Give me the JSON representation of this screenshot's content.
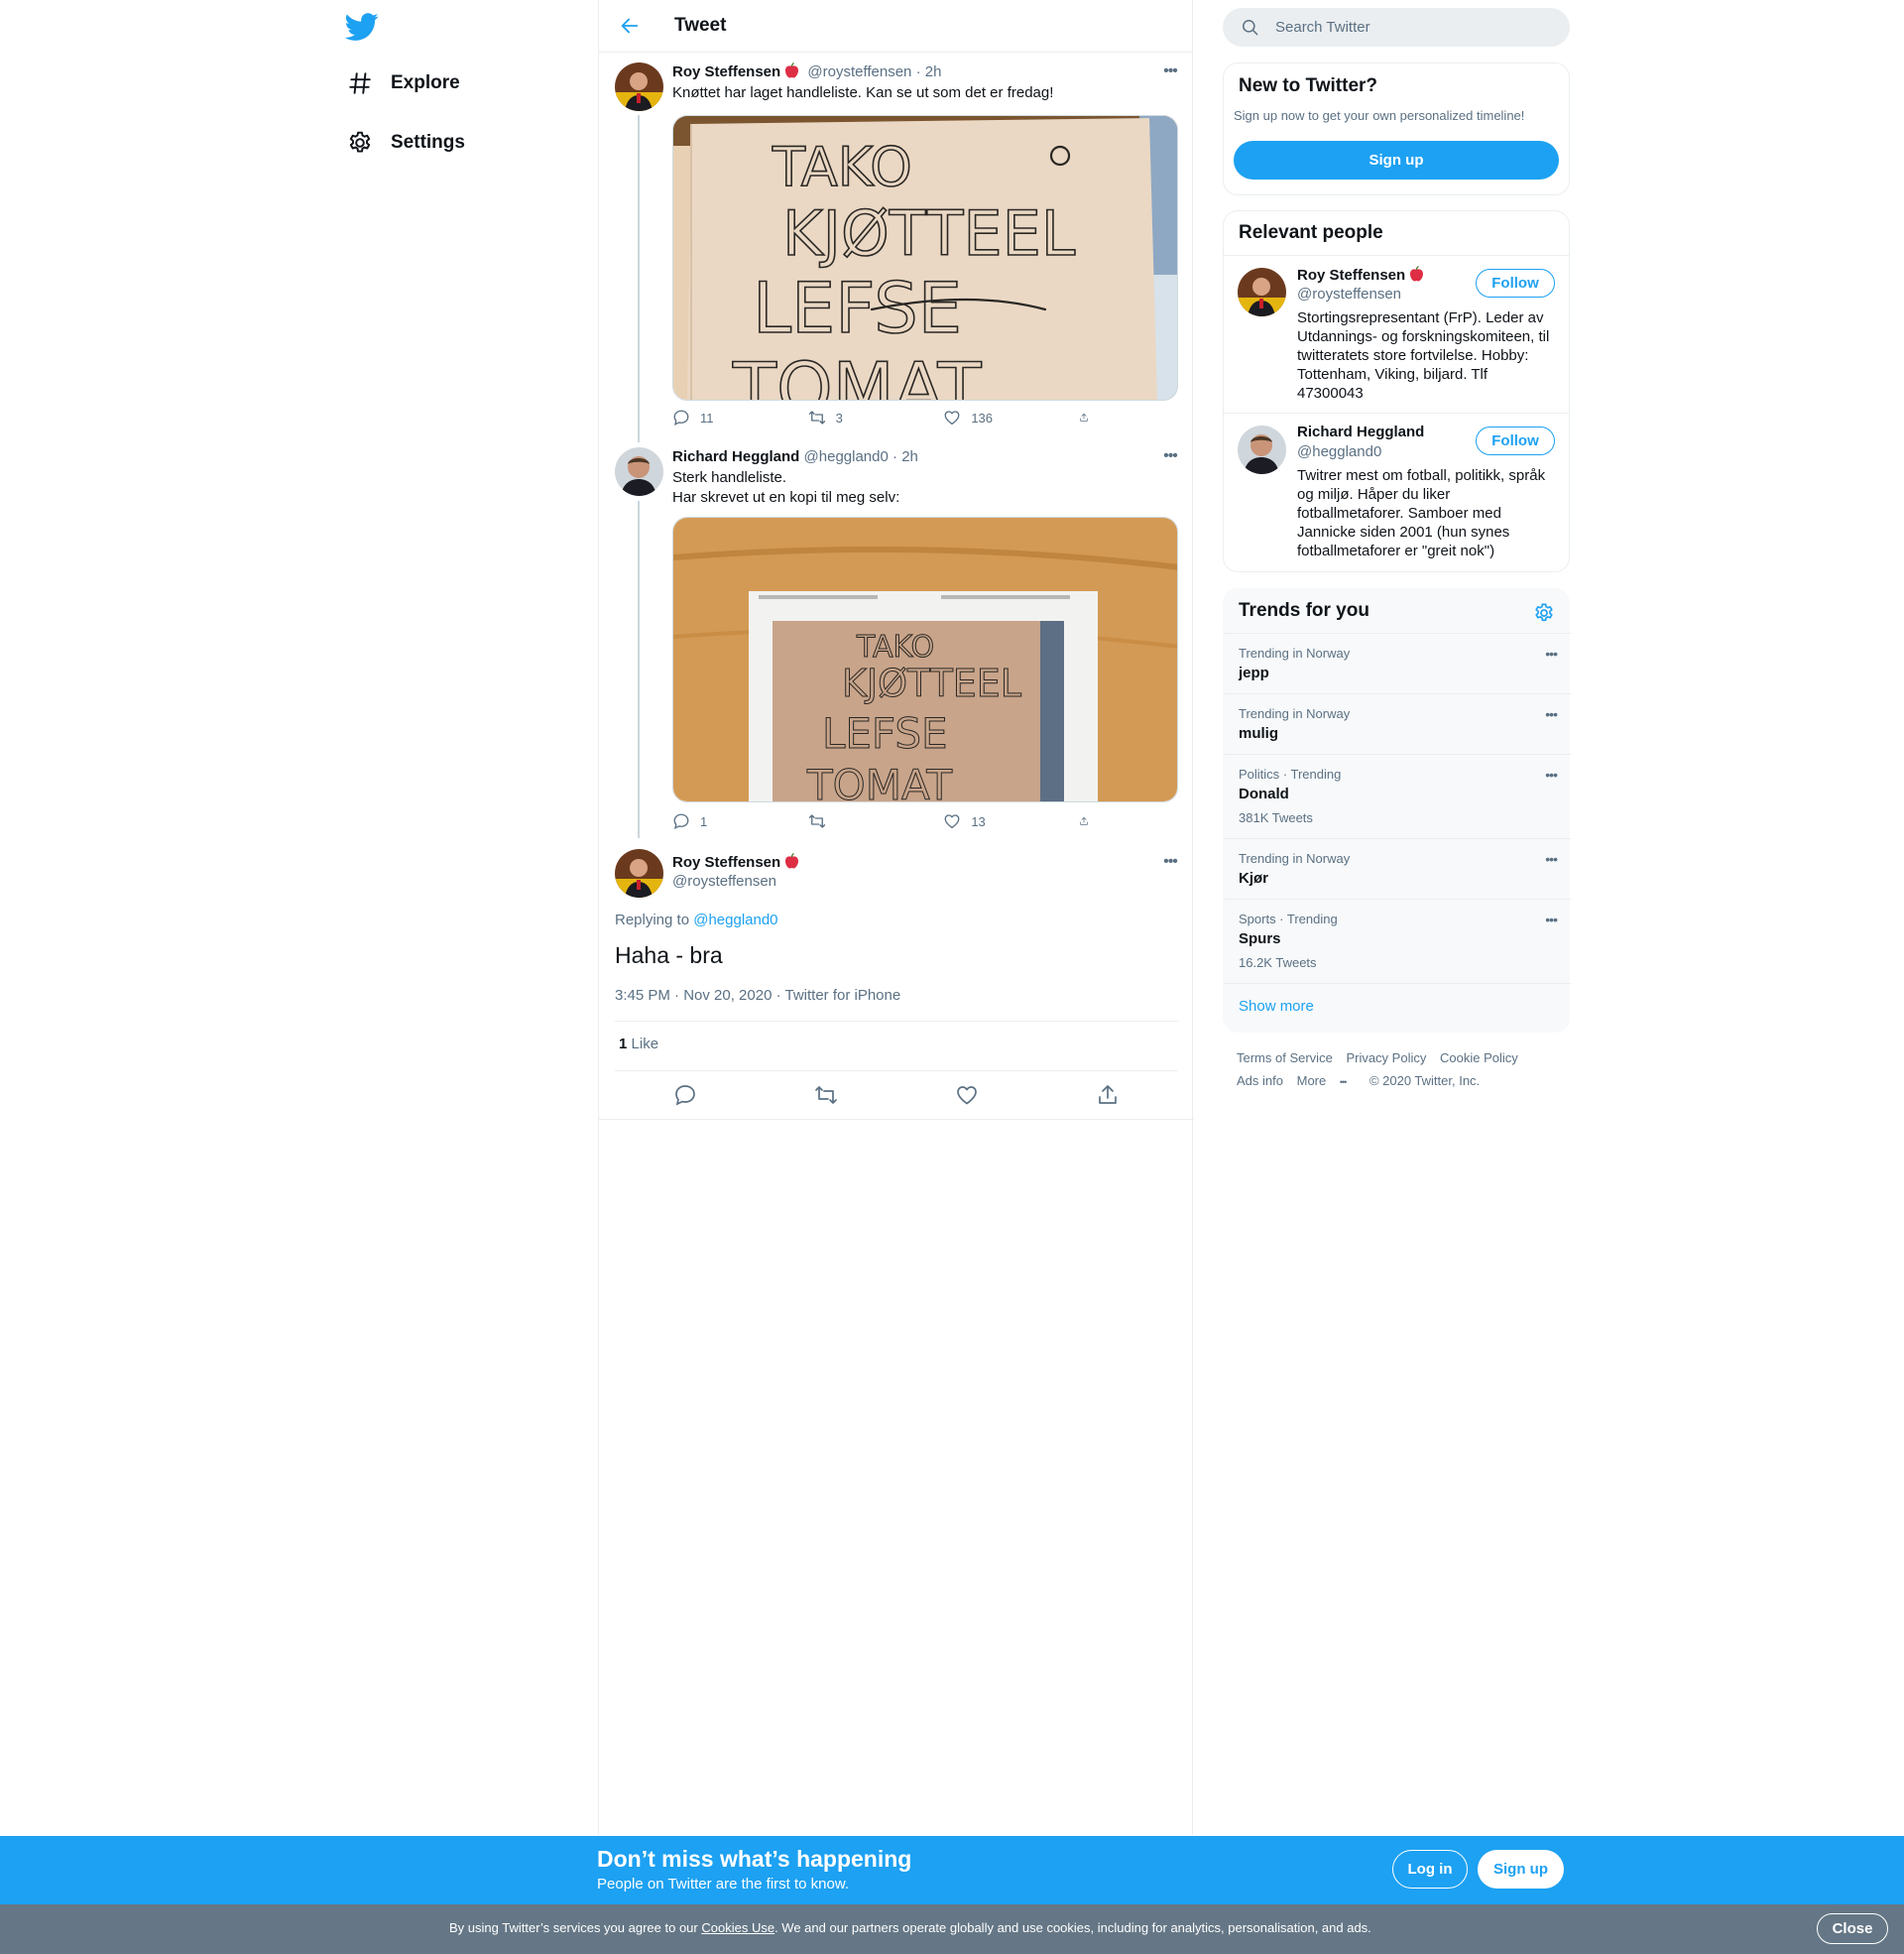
{
  "brand": {
    "accent": "#1da1f2",
    "logo_icon": "twitter-bird-icon"
  },
  "nav": {
    "items": [
      {
        "label": "Explore",
        "icon": "hashtag-icon"
      },
      {
        "label": "Settings",
        "icon": "gear-icon"
      }
    ]
  },
  "header": {
    "title": "Tweet"
  },
  "thread": [
    {
      "name": "Roy Steffensen",
      "handle": "@roysteffensen",
      "sep": "·",
      "time": "2h",
      "text": "Knøttet har laget handleliste. Kan se ut som det er fredag!",
      "media_words": [
        "TAKO",
        "KJØTTEEL",
        "LEFSE",
        "TOMAT"
      ],
      "replies": "11",
      "retweets": "3",
      "likes": "136"
    },
    {
      "name": "Richard Heggland",
      "handle": "@heggland0",
      "sep": "·",
      "time": "2h",
      "text_line1": "Sterk handleliste.",
      "text_line2": "Har skrevet ut en kopi til meg selv:",
      "media_words": [
        "TAKO",
        "KJØTTEEL",
        "LEFSE",
        "TOMAT"
      ],
      "replies": "1",
      "retweets": "",
      "likes": "13"
    }
  ],
  "main_tweet": {
    "name": "Roy Steffensen",
    "handle": "@roysteffensen",
    "replying_prefix": "Replying to",
    "replying_to": "@heggland0",
    "text": "Haha - bra",
    "meta": "3:45 PM · Nov 20, 2020 · Twitter for iPhone",
    "like_count": "1",
    "like_label": "Like"
  },
  "search": {
    "placeholder": "Search Twitter"
  },
  "new_to_twitter": {
    "title": "New to Twitter?",
    "subtitle": "Sign up now to get your own personalized timeline!",
    "button": "Sign up"
  },
  "relevant": {
    "title": "Relevant people",
    "people": [
      {
        "name": "Roy Steffensen",
        "handle": "@roysteffensen",
        "bio": "Stortingsrepresentant (FrP). Leder av Utdannings- og forskningskomiteen, til twitteratets store fortvilelse. Hobby: Tottenham, Viking, biljard. Tlf 47300043",
        "button": "Follow"
      },
      {
        "name": "Richard Heggland",
        "handle": "@heggland0",
        "bio": "Twitrer mest om fotball, politikk, språk og miljø. Håper du liker fotballmetaforer. Samboer med Jannicke siden 2001 (hun synes fotballmetaforer er \"greit nok\")",
        "button": "Follow"
      }
    ]
  },
  "trends": {
    "title": "Trends for you",
    "items": [
      {
        "context": "Trending in Norway",
        "name": "jepp",
        "count": ""
      },
      {
        "context": "Trending in Norway",
        "name": "mulig",
        "count": ""
      },
      {
        "context": "Politics · Trending",
        "name": "Donald",
        "count": "381K Tweets"
      },
      {
        "context": "Trending in Norway",
        "name": "Kjør",
        "count": ""
      },
      {
        "context": "Sports · Trending",
        "name": "Spurs",
        "count": "16.2K Tweets"
      }
    ],
    "show_more": "Show more"
  },
  "footer": {
    "links": [
      "Terms of Service",
      "Privacy Policy",
      "Cookie Policy",
      "Ads info",
      "More"
    ],
    "copyright": "© 2020 Twitter, Inc."
  },
  "banner": {
    "title": "Don’t miss what’s happening",
    "subtitle": "People on Twitter are the first to know.",
    "login": "Log in",
    "signup": "Sign up"
  },
  "cookie": {
    "prefix": "By using Twitter’s services you agree to our",
    "link": "Cookies Use",
    "suffix": ". We and our partners operate globally and use cookies, including for analytics, personalisation, and ads.",
    "close": "Close"
  }
}
